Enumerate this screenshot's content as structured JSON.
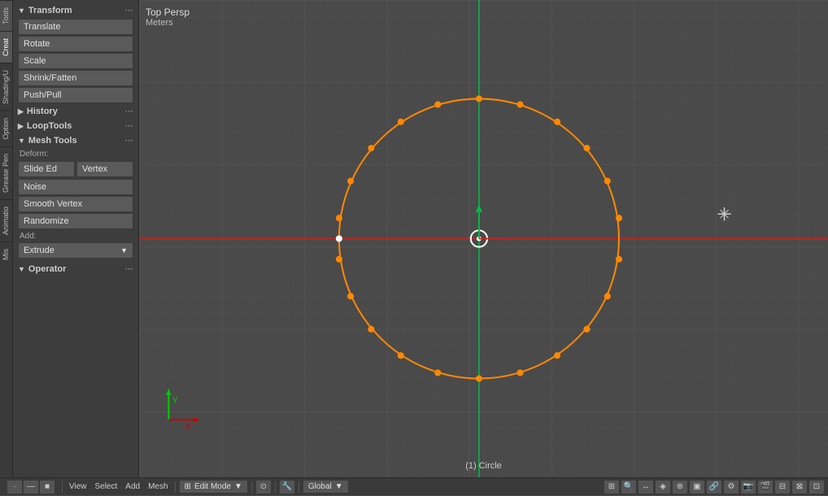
{
  "viewport": {
    "view_name": "Top Persp",
    "units": "Meters",
    "object_name": "(1) Circle",
    "cursor_symbol": "✛"
  },
  "sidebar": {
    "vertical_tabs": [
      {
        "id": "tools",
        "label": "Tools"
      },
      {
        "id": "creat",
        "label": "Creat"
      },
      {
        "id": "shading",
        "label": "Shading/U"
      },
      {
        "id": "option",
        "label": "Option"
      },
      {
        "id": "grease",
        "label": "Grease Pen"
      },
      {
        "id": "animatio",
        "label": "Animatio"
      },
      {
        "id": "mis",
        "label": "Mis"
      }
    ]
  },
  "tool_panel": {
    "transform_section": {
      "label": "Transform",
      "buttons": [
        "Translate",
        "Rotate",
        "Scale",
        "Shrink/Fatten",
        "Push/Pull"
      ]
    },
    "history_section": {
      "label": "History"
    },
    "looptools_section": {
      "label": "LoopTools"
    },
    "mesh_tools_section": {
      "label": "Mesh Tools",
      "deform_label": "Deform:",
      "buttons_row": [
        "Slide Ed",
        "Vertex"
      ],
      "buttons_single": [
        "Noise",
        "Smooth Vertex",
        "Randomize"
      ],
      "add_label": "Add:",
      "extrude_label": "Extrude"
    },
    "operator_section": {
      "label": "Operator"
    }
  },
  "status_bar": {
    "view_label": "View",
    "select_label": "Select",
    "add_label": "Add",
    "mesh_label": "Mesh",
    "mode_label": "Edit Mode",
    "pivot_label": "Global",
    "icons": [
      "⊙",
      "↔",
      "◈",
      "⊕",
      "▣",
      "🔗",
      "⚙",
      "📷",
      "🎬",
      "⊞",
      "⊟",
      "⊠",
      "⊡"
    ]
  },
  "colors": {
    "accent_orange": "#ff8000",
    "accent_green": "#00aa44",
    "accent_red": "#cc2222",
    "grid_line": "#555555",
    "axis_green": "#00cc00",
    "axis_red": "#cc0000",
    "vertex_white": "#ffffff",
    "background": "#4a4a4a"
  }
}
